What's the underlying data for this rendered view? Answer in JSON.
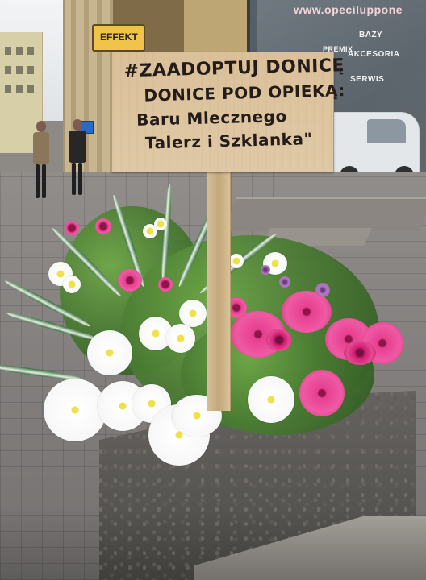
{
  "scene": {
    "storefront_texts": [
      "www.opeciluppone",
      "BAZY",
      "PREMIX",
      "AKCESORIA",
      "SERWIS"
    ],
    "street_sign": "EFFEKT"
  },
  "sign": {
    "lines": [
      "#ZAADOPTUJ DONICĘ",
      "DONICE POD OPIEKĄ:",
      "Baru Mlecznego",
      "Talerz i Szklanka\""
    ]
  },
  "icons": {
    "shop": "storefront-icon",
    "car": "van-icon",
    "plant": "flower-icon"
  }
}
